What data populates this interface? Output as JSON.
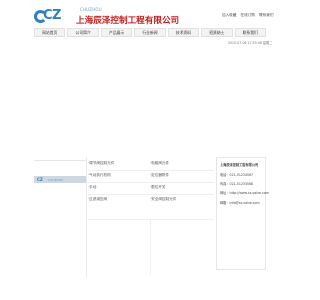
{
  "header": {
    "logo_mark": "CZ",
    "logo_sub": "CHUZHOU",
    "company_name": "上海辰泽控制工程有限公司",
    "top_links": [
      "加入收藏",
      "在线订购",
      "联系我们"
    ]
  },
  "nav": {
    "items": [
      "网站首页",
      "公司简介",
      "产品展示",
      "行业新闻",
      "技术资料",
      "招贤纳士",
      "联系我们"
    ]
  },
  "date_text": "2020-07-06 17:55:46 星期二",
  "side": {
    "mini_logo": "CZ",
    "mini_sub": "CHUZHOU"
  },
  "products": [
    [
      "·调节阀控制元件",
      "·电磁阀元件"
    ],
    [
      "·气动执行机构",
      "·定位器附件"
    ],
    [
      "·手动",
      "·限位开关"
    ],
    [
      "·过滤减压阀",
      "·安全阀控制元件"
    ]
  ],
  "contact": {
    "title": "上海辰泽控制工程有限公司",
    "lines": [
      "电话：021-51234567",
      "传真：021-51234568",
      "网址：http://www.cz-valve.com",
      "邮箱：info@cz-valve.com"
    ]
  }
}
